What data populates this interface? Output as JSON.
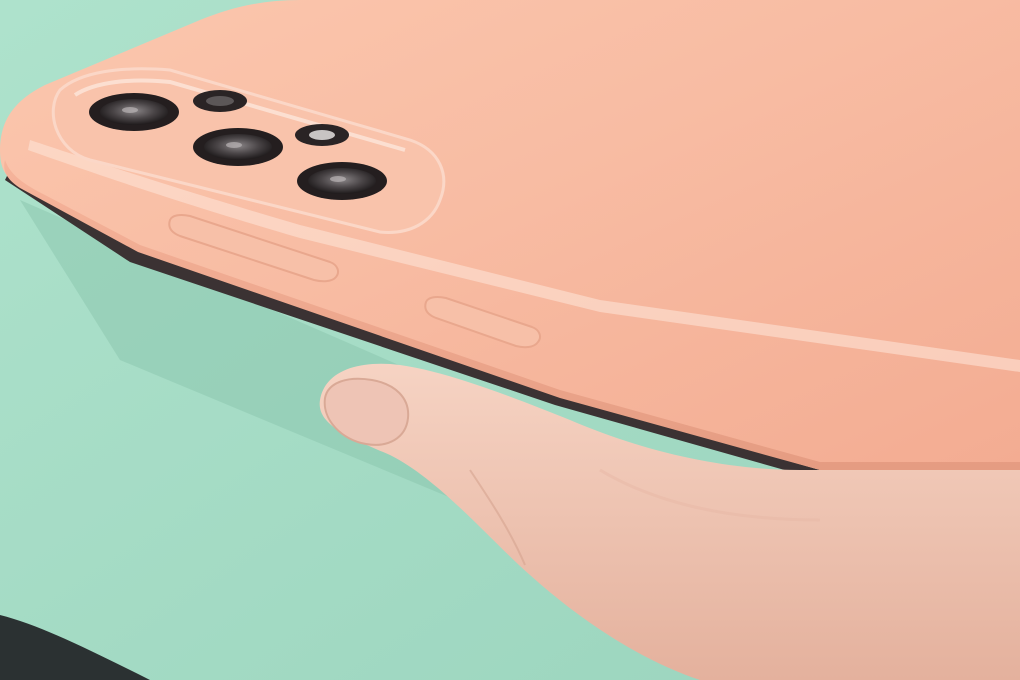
{
  "scene": {
    "subject": "smartphone-rear-in-hand",
    "colors": {
      "background": "#a6dcc6",
      "background_shadow": "#8fc8b1",
      "phone_body": "#f7b9a0",
      "phone_highlight": "#fde0d2",
      "phone_edge_shadow": "#3c3434",
      "lens_ring": "#2b2424",
      "lens_glass": "#6e6a6c",
      "skin": "#f2cbb9",
      "skin_shadow": "#dca792",
      "nail": "#efc3b6",
      "dark_corner": "#2a2f30"
    },
    "icons": {
      "main_camera": "camera-lens-icon",
      "flash": "flash-icon"
    }
  }
}
